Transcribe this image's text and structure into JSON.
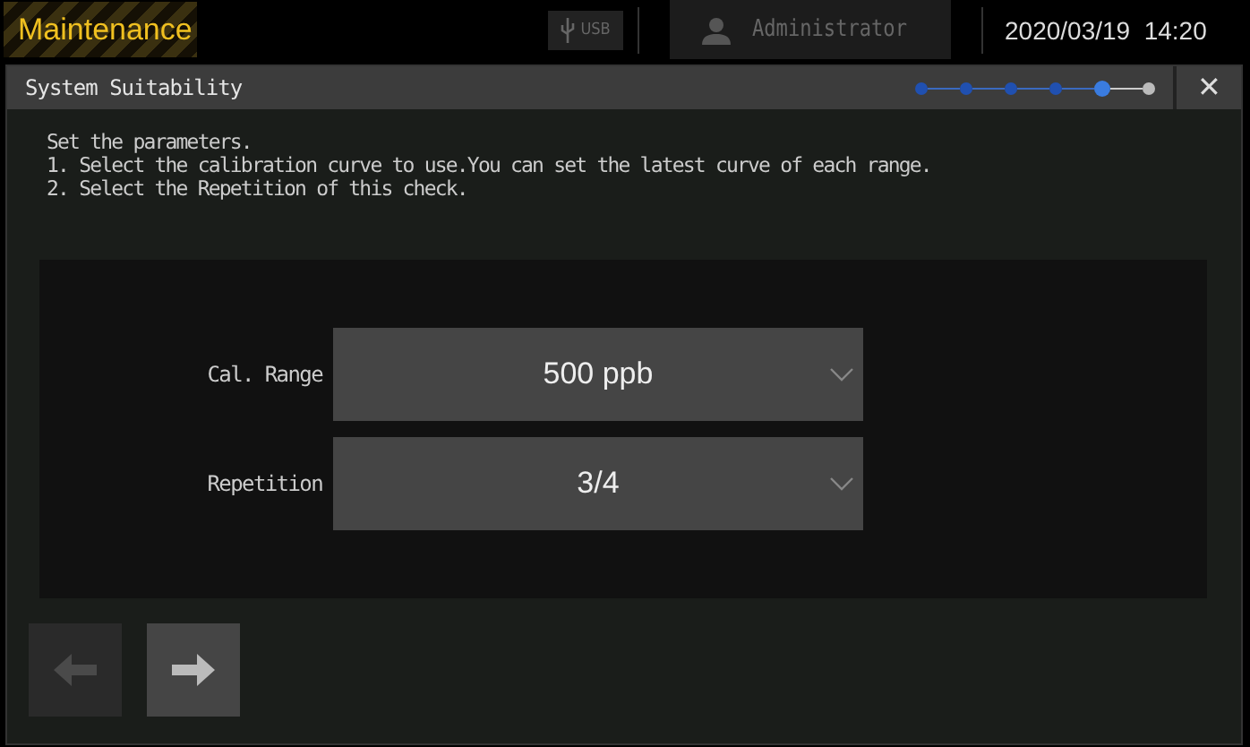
{
  "header": {
    "mode": "Maintenance",
    "usb": "USB",
    "user": "Administrator",
    "datetime": "2020/03/19  14:20"
  },
  "dialog": {
    "title": "System Suitability",
    "steps": [
      {
        "done": true,
        "selected": false
      },
      {
        "done": true,
        "selected": false
      },
      {
        "done": true,
        "selected": false
      },
      {
        "done": true,
        "selected": false
      },
      {
        "done": true,
        "selected": true
      },
      {
        "done": false,
        "selected": false
      }
    ],
    "close": "✕",
    "instructions": [
      "Set the parameters.",
      "1. Select the calibration curve to use.You can set the latest curve of each range.",
      "2. Select the Repetition of this check."
    ],
    "fields": [
      {
        "label": "Cal. Range",
        "value": "500 ppb"
      },
      {
        "label": "Repetition",
        "value": "3/4"
      }
    ],
    "back": {
      "disabled": true
    },
    "next": {
      "disabled": false
    }
  }
}
